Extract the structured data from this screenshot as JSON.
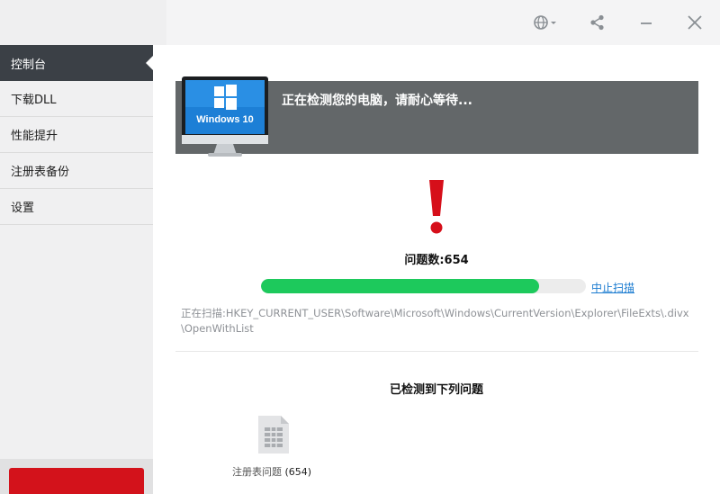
{
  "titlebar": {
    "icons": [
      "globe-icon",
      "share-icon",
      "minimize-icon",
      "close-icon"
    ]
  },
  "sidebar": {
    "items": [
      {
        "label": "控制台",
        "active": true
      },
      {
        "label": "下载DLL",
        "active": false
      },
      {
        "label": "性能提升",
        "active": false
      },
      {
        "label": "注册表备份",
        "active": false
      },
      {
        "label": "设置",
        "active": false
      }
    ]
  },
  "banner": {
    "text": "正在检测您的电脑，请耐心等待...",
    "monitor_label": "Windows 10"
  },
  "scan": {
    "issues_label": "问题数:654",
    "progress_fraction": 0.855,
    "stop_label": "中止扫描",
    "path_text": "正在扫描:HKEY_CURRENT_USER\\Software\\Microsoft\\Windows\\CurrentVersion\\Explorer\\FileExts\\.divx\\OpenWithList"
  },
  "results": {
    "title": "已检测到下列问题",
    "items": [
      {
        "label": "注册表问题",
        "count": "(654)"
      }
    ]
  },
  "colors": {
    "accent_green": "#1dc95c",
    "sidebar_active": "#3b4046",
    "banner_bg": "#636769",
    "brand_red": "#d3121b",
    "link_blue": "#1a7bd0"
  }
}
